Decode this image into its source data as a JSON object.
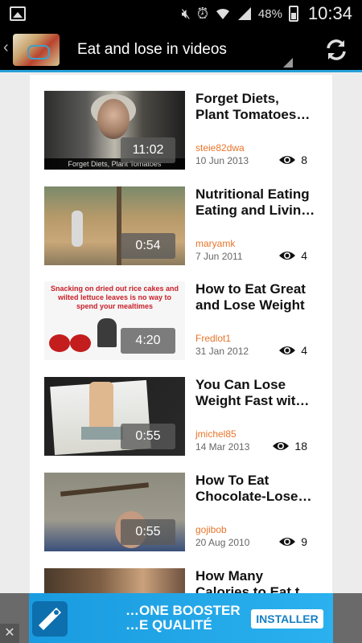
{
  "status_bar": {
    "icons": [
      "gallery-icon",
      "mute-icon",
      "alarm-icon",
      "wifi-icon",
      "signal-icon",
      "battery-icon"
    ],
    "battery": "48%",
    "time": "10:34"
  },
  "action_bar": {
    "title": "Eat and lose in videos",
    "refresh_icon": "refresh-icon"
  },
  "videos": [
    {
      "title": "Forget Diets,\nPlant Tomatoes…",
      "duration": "11:02",
      "author": "steie82dwa",
      "date": "10 Jun 2013",
      "views": "8",
      "thumb_caption": "Forget Diets, Plant Tomatoes"
    },
    {
      "title": "Nutritional Eating\nEating and Livin…",
      "duration": "0:54",
      "author": "maryamk",
      "date": "7 Jun 2011",
      "views": "4"
    },
    {
      "title": "How to Eat Great\nand Lose Weight",
      "duration": "4:20",
      "author": "Fredlot1",
      "date": "31 Jan 2012",
      "views": "4",
      "thumb_headline": "Snacking on dried out rice cakes and wilted lettuce leaves is no way to spend your mealtimes"
    },
    {
      "title": "You Can Lose\nWeight Fast wit…",
      "duration": "0:55",
      "author": "jmichel85",
      "date": "14 Mar 2013",
      "views": "18"
    },
    {
      "title": "How To Eat\nChocolate-Lose…",
      "duration": "0:55",
      "author": "gojibob",
      "date": "20 Aug 2010",
      "views": "9"
    },
    {
      "title": "How Many\nCalories to Eat t…"
    }
  ],
  "ad": {
    "text": "…ONE BOOSTER\n…E QUALITÉ",
    "button": "INSTALLER",
    "close": "✕"
  },
  "colors": {
    "accent": "#27a0d8",
    "author": "#e8742a",
    "ad_background": "#1a9be0"
  }
}
